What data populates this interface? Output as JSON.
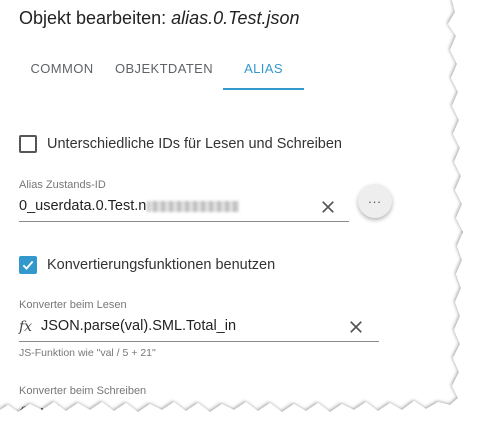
{
  "dialog": {
    "title_prefix": "Objekt bearbeiten: ",
    "title_object": "alias.0.Test.json"
  },
  "tabs": [
    {
      "label": "COMMON",
      "active": false
    },
    {
      "label": "OBJEKTDATEN",
      "active": false
    },
    {
      "label": "ALIAS",
      "active": true
    }
  ],
  "alias": {
    "separate_ids": {
      "label": "Unterschiedliche IDs für Lesen und Schreiben",
      "checked": false
    },
    "state_id": {
      "label": "Alias Zustands-ID",
      "value": "0_userdata.0.Test.n"
    },
    "more_label": "...",
    "use_conversion": {
      "label": "Konvertierungsfunktionen benutzen",
      "checked": true
    },
    "read_converter": {
      "label": "Konverter beim Lesen",
      "value": "JSON.parse(val).SML.Total_in",
      "helper": "JS-Funktion wie \"val / 5 + 21\""
    },
    "write_converter": {
      "label": "Konverter beim Schreiben",
      "value": "val"
    }
  },
  "colors": {
    "accent": "#3399cc",
    "text": "#222222",
    "label": "#777777"
  },
  "icons": {
    "clear": "close-icon",
    "function": "fx-icon",
    "check": "check-icon"
  }
}
